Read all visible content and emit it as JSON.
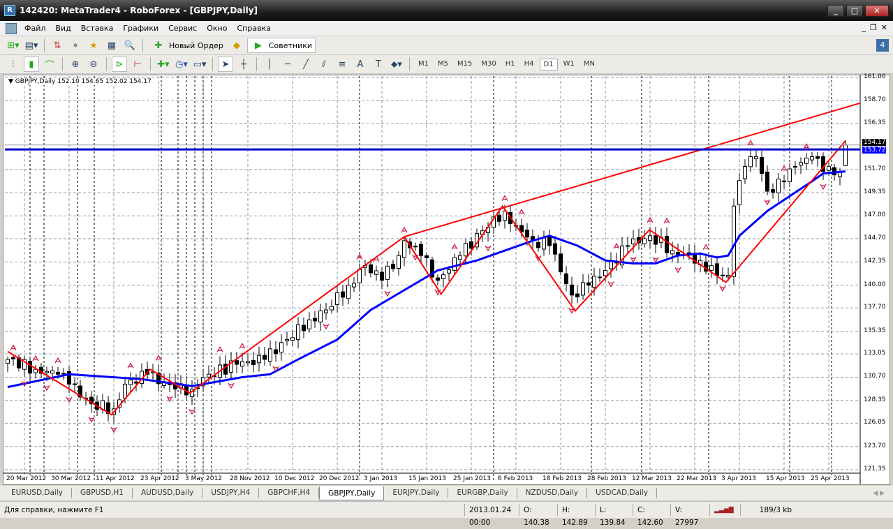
{
  "window": {
    "title": "142420: MetaTrader4 - RoboForex - [GBPJPY,Daily]",
    "logo": "R"
  },
  "menu": [
    "Файл",
    "Вид",
    "Вставка",
    "Графики",
    "Сервис",
    "Окно",
    "Справка"
  ],
  "toolbar": {
    "new_order": "Новый Ордер",
    "experts": "Советники",
    "notifications": "4"
  },
  "timeframes": [
    "M1",
    "M5",
    "M15",
    "M30",
    "H1",
    "H4",
    "D1",
    "W1",
    "MN"
  ],
  "active_timeframe": "D1",
  "chart_header": "GBPJPY,Daily  152.10 154.65 152.02 154.17",
  "chart_data": {
    "type": "candlestick",
    "symbol": "GBPJPY",
    "period": "Daily",
    "ohlc_last": {
      "open": 152.1,
      "high": 154.65,
      "low": 152.02,
      "close": 154.17
    },
    "ylim": [
      121.35,
      161.0
    ],
    "y_ticks": [
      "161.00",
      "158.70",
      "156.35",
      "154.17",
      "153.72",
      "151.70",
      "149.35",
      "147.00",
      "144.70",
      "142.35",
      "140.00",
      "137.70",
      "135.35",
      "133.05",
      "130.70",
      "128.35",
      "126.05",
      "123.70",
      "121.35"
    ],
    "y_tick_values": [
      161.0,
      158.7,
      156.35,
      154.17,
      153.72,
      151.7,
      149.35,
      147.0,
      144.7,
      142.35,
      140.0,
      137.7,
      135.35,
      133.05,
      130.7,
      128.35,
      126.05,
      123.7,
      121.35
    ],
    "bar_count": 151,
    "x_labels": [
      {
        "bar": 3,
        "text": "20 Mar 2012"
      },
      {
        "bar": 11,
        "text": "30 Mar 2012"
      },
      {
        "bar": 19,
        "text": "11 Apr 2012"
      },
      {
        "bar": 27,
        "text": "23 Apr 2012"
      },
      {
        "bar": 35,
        "text": "3 May 2012"
      },
      {
        "bar": 43,
        "text": "28 Nov 2012"
      },
      {
        "bar": 51,
        "text": "10 Dec 2012"
      },
      {
        "bar": 59,
        "text": "20 Dec 2012"
      },
      {
        "bar": 67,
        "text": "3 Jan 2013"
      },
      {
        "bar": 75,
        "text": "15 Jan 2013"
      },
      {
        "bar": 83,
        "text": "25 Jan 2013"
      },
      {
        "bar": 91,
        "text": "6 Feb 2013"
      },
      {
        "bar": 99,
        "text": "18 Feb 2013"
      },
      {
        "bar": 107,
        "text": "28 Feb 2013"
      },
      {
        "bar": 115,
        "text": "12 Mar 2013"
      },
      {
        "bar": 123,
        "text": "22 Mar 2013"
      },
      {
        "bar": 131,
        "text": "3 Apr 2013"
      },
      {
        "bar": 139,
        "text": "15 Apr 2013"
      },
      {
        "bar": 147,
        "text": "25 Apr 2013"
      }
    ],
    "close_anchors": [
      [
        0,
        132.5
      ],
      [
        5,
        131.5
      ],
      [
        9,
        131
      ],
      [
        11,
        130
      ],
      [
        15,
        128
      ],
      [
        19,
        127.5
      ],
      [
        21,
        130
      ],
      [
        25,
        131
      ],
      [
        30,
        129.5
      ],
      [
        33,
        129.5
      ],
      [
        36,
        131
      ],
      [
        41,
        132
      ],
      [
        46,
        132.5
      ],
      [
        50,
        134.5
      ],
      [
        54,
        136.5
      ],
      [
        57,
        137.5
      ],
      [
        61,
        140
      ],
      [
        64,
        142
      ],
      [
        67,
        140.5
      ],
      [
        70,
        143
      ],
      [
        71,
        144.5
      ],
      [
        74,
        143
      ],
      [
        77,
        140.5
      ],
      [
        81,
        143
      ],
      [
        85,
        145.5
      ],
      [
        89,
        147.5
      ],
      [
        91,
        146
      ],
      [
        94,
        144.5
      ],
      [
        97,
        144
      ],
      [
        101,
        139
      ],
      [
        104,
        140
      ],
      [
        107,
        141.5
      ],
      [
        111,
        144
      ],
      [
        115,
        145
      ],
      [
        119,
        143.5
      ],
      [
        124,
        142.5
      ],
      [
        127,
        141
      ],
      [
        129,
        141
      ],
      [
        130,
        148
      ],
      [
        132,
        152
      ],
      [
        134,
        153
      ],
      [
        136,
        149.5
      ],
      [
        139,
        150.5
      ],
      [
        141,
        152
      ],
      [
        144,
        153
      ],
      [
        146,
        151.5
      ],
      [
        149,
        151.5
      ],
      [
        150,
        154.17
      ]
    ],
    "moving_average": [
      [
        0,
        129.7
      ],
      [
        11,
        131
      ],
      [
        24,
        130.5
      ],
      [
        33,
        129.8
      ],
      [
        42,
        130.7
      ],
      [
        47,
        131
      ],
      [
        52,
        132.5
      ],
      [
        59,
        134.5
      ],
      [
        65,
        137.5
      ],
      [
        71,
        139.5
      ],
      [
        77,
        141.5
      ],
      [
        84,
        142.5
      ],
      [
        89,
        143.5
      ],
      [
        94,
        144.5
      ],
      [
        97,
        145
      ],
      [
        102,
        144
      ],
      [
        107,
        142.5
      ],
      [
        112,
        142.2
      ],
      [
        116,
        142.2
      ],
      [
        120,
        143
      ],
      [
        124,
        143.2
      ],
      [
        127,
        142.8
      ],
      [
        129,
        143
      ],
      [
        131,
        145
      ],
      [
        134,
        146.5
      ],
      [
        136,
        147.5
      ],
      [
        140,
        149
      ],
      [
        144,
        150.5
      ],
      [
        146,
        151.3
      ],
      [
        150,
        151.5
      ]
    ],
    "zigzag": [
      [
        0,
        133.3
      ],
      [
        18.6,
        126.9
      ],
      [
        25.5,
        131.5
      ],
      [
        32.6,
        129.1
      ],
      [
        71,
        144.9
      ],
      [
        77.6,
        139.1
      ],
      [
        88.6,
        148.0
      ],
      [
        101.6,
        137.4
      ],
      [
        114.9,
        145.6
      ],
      [
        128.6,
        140.3
      ],
      [
        150,
        154.6
      ]
    ],
    "trendline": [
      [
        71,
        144.9
      ],
      [
        152.6,
        158.4
      ]
    ],
    "horizontal_line": 153.72,
    "price_line": 154.17,
    "fractals_up": [
      1,
      5,
      9,
      22,
      27,
      38,
      42,
      63,
      66,
      71,
      80,
      89,
      92,
      109,
      115,
      118,
      125,
      133,
      139,
      143
    ],
    "fractals_down": [
      3,
      7,
      11,
      15,
      19,
      29,
      33,
      40,
      48,
      57,
      68,
      73,
      77,
      86,
      95,
      101,
      108,
      112,
      116,
      120,
      128,
      136,
      146
    ],
    "separators": [
      4,
      6.5,
      12.5,
      15.5,
      27.5,
      30.5,
      32,
      33.5,
      35,
      36.5,
      63,
      87,
      104.5,
      113.5,
      125.5,
      140,
      147.5
    ],
    "colors": {
      "bull": "#ffffff",
      "bear": "#000000",
      "ma": "#0000ff",
      "zigzag": "#ff0000",
      "hline": "#0000cc",
      "fractal": "#cc2244"
    }
  },
  "tabs": [
    "EURUSD,Daily",
    "GBPUSD,H1",
    "AUDUSD,Daily",
    "USDJPY,H4",
    "GBPCHF,H4",
    "GBPJPY,Daily",
    "EURJPY,Daily",
    "EURGBP,Daily",
    "NZDUSD,Daily",
    "USDCAD,Daily"
  ],
  "active_tab": "GBPJPY,Daily",
  "status": {
    "help": "Для справки, нажмите F1",
    "datetime": "2013.01.24 00:00",
    "open": "O: 140.38",
    "high": "H: 142.89",
    "low": "L: 139.84",
    "close": "C: 142.60",
    "volume": "V: 27997",
    "traffic": "189/3 kb"
  }
}
